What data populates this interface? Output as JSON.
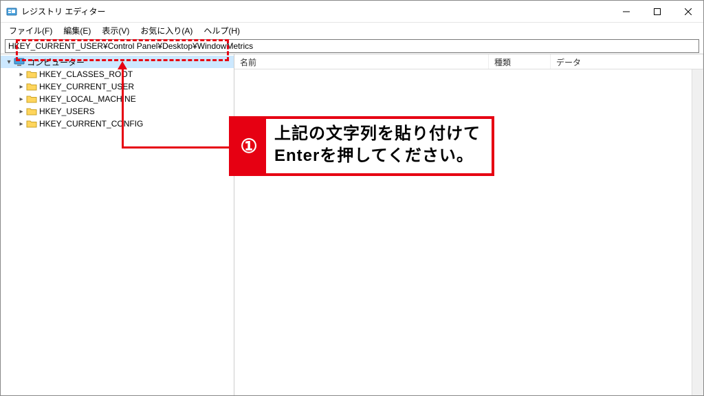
{
  "window": {
    "title": "レジストリ エディター"
  },
  "menu": {
    "file": "ファイル(F)",
    "edit": "編集(E)",
    "view": "表示(V)",
    "favorites": "お気に入り(A)",
    "help": "ヘルプ(H)"
  },
  "address": {
    "value": "HKEY_CURRENT_USER¥Control Panel¥Desktop¥WindowMetrics"
  },
  "tree": {
    "root": "コンピューター",
    "items": [
      "HKEY_CLASSES_ROOT",
      "HKEY_CURRENT_USER",
      "HKEY_LOCAL_MACHINE",
      "HKEY_USERS",
      "HKEY_CURRENT_CONFIG"
    ]
  },
  "list": {
    "headers": {
      "name": "名前",
      "type": "種類",
      "data": "データ"
    }
  },
  "annotation": {
    "number": "①",
    "line1": "上記の文字列を貼り付けて",
    "line2": "Enterを押してください。"
  }
}
